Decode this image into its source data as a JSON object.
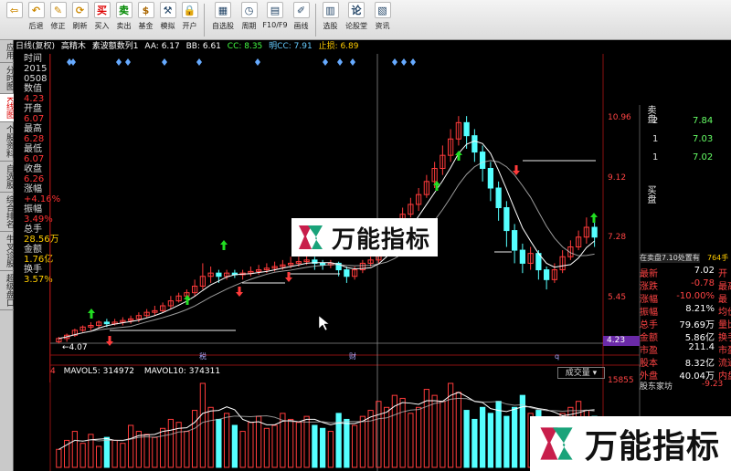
{
  "toolbar": {
    "buttons": [
      {
        "label": "",
        "icon": "back-icon",
        "glyph": "⇦"
      },
      {
        "label": "后退",
        "icon": "undo-icon",
        "glyph": "↶"
      },
      {
        "label": "修正",
        "icon": "fix-icon",
        "glyph": "✎"
      },
      {
        "label": "刷新",
        "icon": "refresh-icon",
        "glyph": "⟳"
      },
      {
        "label": "买入",
        "icon": "buy-icon",
        "glyph": "买"
      },
      {
        "label": "卖出",
        "icon": "sell-icon",
        "glyph": "卖"
      },
      {
        "label": "基金",
        "icon": "fund-icon",
        "glyph": "$"
      },
      {
        "label": "模拟",
        "icon": "gavel-icon",
        "glyph": "⚒"
      },
      {
        "label": "开户",
        "icon": "lock-icon",
        "glyph": "🔒"
      },
      {
        "label": "自选股",
        "icon": "watchlist-icon",
        "glyph": "▦"
      },
      {
        "label": "周期",
        "icon": "period-icon",
        "glyph": "◷"
      },
      {
        "label": "F10/F9",
        "icon": "f10-icon",
        "glyph": "▤"
      },
      {
        "label": "画线",
        "icon": "draw-icon",
        "glyph": "✐"
      },
      {
        "label": "选股",
        "icon": "pick-icon",
        "glyph": "▥"
      },
      {
        "label": "论股堂",
        "icon": "forum-icon",
        "glyph": "论"
      },
      {
        "label": "资讯",
        "icon": "news-icon",
        "glyph": "▧"
      }
    ]
  },
  "sidebar": {
    "tabs": [
      {
        "label": "应用",
        "active": false
      },
      {
        "label": "分时图",
        "active": false
      },
      {
        "label": "K线图",
        "active": true
      },
      {
        "label": "个股资料",
        "active": false
      },
      {
        "label": "自选股",
        "active": false
      },
      {
        "label": "综合排名",
        "active": false
      },
      {
        "label": "牛叉诊股",
        "active": false
      },
      {
        "label": "超级盘口",
        "active": false
      }
    ]
  },
  "infobar": {
    "period": "日线(复权)",
    "stock": "高精木",
    "indicator": "素波额数列1",
    "aa": "AA: 6.17",
    "bb": "BB: 6.61",
    "cc": "CC: 8.35",
    "mcc": "明CC: 7.91",
    "stop": "止损: 6.89"
  },
  "datapanel": [
    {
      "text": "时间",
      "cls": "l"
    },
    {
      "text": "2015",
      "cls": "l"
    },
    {
      "text": "0508",
      "cls": "l"
    },
    {
      "text": "数值",
      "cls": "l"
    },
    {
      "text": "4.23",
      "cls": "r"
    },
    {
      "text": "开盘",
      "cls": "l"
    },
    {
      "text": "6.07",
      "cls": "r"
    },
    {
      "text": "最高",
      "cls": "l"
    },
    {
      "text": "6.28",
      "cls": "r"
    },
    {
      "text": "最低",
      "cls": "l"
    },
    {
      "text": "6.07",
      "cls": "r"
    },
    {
      "text": "收盘",
      "cls": "l"
    },
    {
      "text": "6.26",
      "cls": "r"
    },
    {
      "text": "涨幅",
      "cls": "l"
    },
    {
      "text": "+4.16%",
      "cls": "r"
    },
    {
      "text": "振幅",
      "cls": "l"
    },
    {
      "text": "3.49%",
      "cls": "r"
    },
    {
      "text": "总手",
      "cls": "l"
    },
    {
      "text": "28.56万",
      "cls": "y"
    },
    {
      "text": "金额",
      "cls": "l"
    },
    {
      "text": "1.76亿",
      "cls": "y"
    },
    {
      "text": "换手",
      "cls": "l"
    },
    {
      "text": "3.57%",
      "cls": "y"
    }
  ],
  "price_axis": {
    "ticks": [
      {
        "label": "10.96",
        "v": 10.96
      },
      {
        "label": "9.12",
        "v": 9.12
      },
      {
        "label": "7.28",
        "v": 7.28
      },
      {
        "label": "5.45",
        "v": 5.45
      }
    ],
    "current": "4.23",
    "low_label": "4.07"
  },
  "markers": [
    {
      "label": "税"
    },
    {
      "label": "财"
    },
    {
      "label": "q"
    }
  ],
  "volume": {
    "mavol5": "MAVOL5: 314972",
    "mavol10": "MAVOL10: 374311",
    "prefix": "4",
    "selector": "成交量",
    "axis_top": "15855"
  },
  "rightpanel": {
    "sell_label": "卖盘",
    "buy_label": "买盘",
    "sells": [
      {
        "n": "2",
        "p": "7.84"
      },
      {
        "n": "1",
        "p": "7.03"
      },
      {
        "n": "1",
        "p": "7.02"
      }
    ],
    "status": "在卖盘7.10处置有",
    "status_vol": "764手",
    "rows": [
      {
        "k": "最新",
        "v": "7.02",
        "k2": "开"
      },
      {
        "k": "涨跌",
        "v": "-0.78",
        "k2": "最高"
      },
      {
        "k": "涨幅",
        "v": "-10.00%",
        "k2": "最"
      },
      {
        "k": "振幅",
        "v": "8.21%",
        "k2": "均价"
      },
      {
        "k": "总手",
        "v": "79.69万",
        "k2": "量比"
      },
      {
        "k": "金额",
        "v": "5.86亿",
        "k2": "换手"
      },
      {
        "k": "市盈",
        "v": "211.4",
        "k2": "市盈"
      },
      {
        "k": "股本",
        "v": "8.32亿",
        "k2": "流通"
      },
      {
        "k": "外盘",
        "v": "40.04万",
        "k2": "内盘"
      }
    ],
    "footer": "股东家坊",
    "footer_val": "-9.23"
  },
  "watermark": {
    "text": "万能指标"
  },
  "colors": {
    "up": "#ff3b3b",
    "down": "#55ffff",
    "green": "#22dd22",
    "grid": "#8a1010"
  },
  "chart_data": {
    "type": "candlestick",
    "ylim": [
      4.0,
      11.2
    ],
    "candles": [
      [
        4.1,
        4.2,
        4.05,
        4.25
      ],
      [
        4.2,
        4.3,
        4.1,
        4.35
      ],
      [
        4.3,
        4.45,
        4.25,
        4.5
      ],
      [
        4.45,
        4.55,
        4.4,
        4.6
      ],
      [
        4.55,
        4.6,
        4.45,
        4.7
      ],
      [
        4.6,
        4.7,
        4.5,
        4.75
      ],
      [
        4.7,
        4.65,
        4.55,
        4.8
      ],
      [
        4.65,
        4.7,
        4.6,
        4.8
      ],
      [
        4.7,
        4.75,
        4.6,
        4.85
      ],
      [
        4.75,
        4.8,
        4.65,
        4.9
      ],
      [
        4.8,
        4.9,
        4.7,
        5.0
      ],
      [
        4.9,
        5.0,
        4.85,
        5.1
      ],
      [
        5.0,
        5.05,
        4.9,
        5.2
      ],
      [
        5.05,
        5.2,
        5.0,
        5.3
      ],
      [
        5.2,
        5.35,
        5.1,
        5.5
      ],
      [
        5.35,
        5.5,
        5.3,
        5.6
      ],
      [
        5.5,
        5.6,
        5.4,
        5.7
      ],
      [
        5.6,
        5.8,
        5.5,
        6.0
      ],
      [
        5.8,
        6.1,
        5.7,
        6.5
      ],
      [
        6.1,
        6.2,
        5.9,
        6.4
      ],
      [
        6.2,
        6.1,
        5.9,
        6.3
      ],
      [
        6.1,
        6.2,
        6.0,
        6.3
      ],
      [
        6.2,
        6.15,
        6.05,
        6.3
      ],
      [
        6.15,
        6.2,
        6.0,
        6.3
      ],
      [
        6.2,
        6.25,
        6.1,
        6.4
      ],
      [
        6.25,
        6.3,
        6.15,
        6.45
      ],
      [
        6.3,
        6.35,
        6.2,
        6.5
      ],
      [
        6.35,
        6.4,
        6.25,
        6.55
      ],
      [
        6.4,
        6.45,
        6.3,
        6.6
      ],
      [
        6.45,
        6.5,
        6.35,
        6.7
      ],
      [
        6.5,
        6.55,
        6.4,
        6.7
      ],
      [
        6.55,
        6.6,
        6.45,
        6.75
      ],
      [
        6.6,
        6.5,
        6.3,
        6.7
      ],
      [
        6.5,
        6.45,
        6.3,
        6.6
      ],
      [
        6.45,
        6.5,
        6.35,
        6.6
      ],
      [
        6.5,
        6.3,
        6.1,
        6.55
      ],
      [
        6.3,
        6.1,
        5.9,
        6.4
      ],
      [
        6.1,
        6.3,
        6.0,
        6.4
      ],
      [
        6.3,
        6.5,
        6.2,
        6.6
      ],
      [
        6.5,
        6.6,
        6.4,
        6.7
      ],
      [
        6.6,
        6.9,
        6.5,
        7.0
      ],
      [
        6.9,
        7.2,
        6.8,
        7.3
      ],
      [
        7.2,
        7.6,
        7.1,
        7.8
      ],
      [
        7.6,
        8.0,
        7.5,
        8.2
      ],
      [
        8.0,
        8.3,
        7.9,
        8.5
      ],
      [
        8.3,
        8.6,
        8.1,
        8.8
      ],
      [
        8.6,
        9.0,
        8.5,
        9.2
      ],
      [
        9.0,
        9.4,
        8.8,
        9.6
      ],
      [
        9.4,
        9.8,
        9.2,
        10.1
      ],
      [
        9.8,
        10.3,
        9.6,
        10.6
      ],
      [
        10.3,
        10.8,
        10.1,
        11.0
      ],
      [
        10.8,
        10.4,
        10.0,
        11.0
      ],
      [
        10.4,
        9.9,
        9.6,
        10.6
      ],
      [
        9.9,
        9.4,
        9.0,
        10.1
      ],
      [
        9.4,
        8.8,
        8.4,
        9.6
      ],
      [
        8.8,
        8.2,
        7.8,
        9.0
      ],
      [
        8.2,
        7.5,
        7.0,
        8.4
      ],
      [
        7.5,
        6.9,
        6.5,
        7.7
      ],
      [
        6.9,
        6.5,
        6.2,
        7.1
      ],
      [
        6.5,
        6.8,
        6.3,
        7.0
      ],
      [
        6.8,
        6.3,
        6.0,
        6.9
      ],
      [
        6.3,
        6.0,
        5.7,
        6.4
      ],
      [
        6.0,
        6.3,
        5.9,
        6.5
      ],
      [
        6.3,
        6.7,
        6.2,
        6.9
      ],
      [
        6.7,
        7.0,
        6.6,
        7.2
      ],
      [
        7.0,
        7.3,
        6.9,
        7.5
      ],
      [
        7.3,
        7.6,
        7.1,
        7.9
      ],
      [
        7.6,
        7.3,
        7.0,
        7.9
      ]
    ],
    "volumes": [
      30,
      45,
      60,
      40,
      55,
      35,
      50,
      45,
      40,
      70,
      60,
      55,
      50,
      65,
      80,
      75,
      60,
      95,
      140,
      100,
      80,
      90,
      70,
      60,
      75,
      85,
      65,
      70,
      90,
      80,
      75,
      85,
      70,
      65,
      60,
      90,
      80,
      70,
      85,
      95,
      110,
      100,
      120,
      115,
      90,
      100,
      130,
      120,
      110,
      140,
      125,
      95,
      80,
      100,
      90,
      110,
      85,
      100,
      120,
      90,
      95,
      75,
      80,
      90,
      100,
      110,
      95,
      85
    ]
  }
}
